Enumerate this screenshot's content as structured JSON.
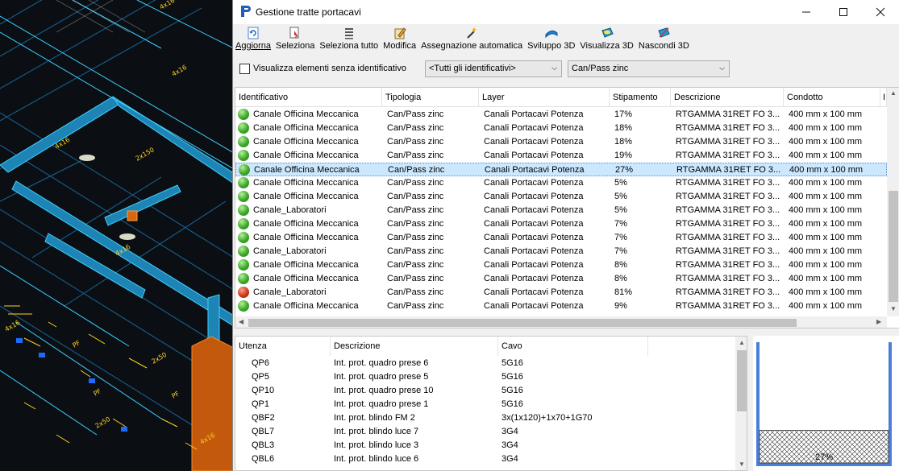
{
  "cad_labels": [
    "4x16",
    "4x16",
    "2x150",
    "4x16",
    "4x16",
    "PF",
    "PF",
    "2x50",
    "4x16",
    "2x50",
    "PF",
    "4x16"
  ],
  "window": {
    "title": "Gestione tratte portacavi",
    "icon": "app-logo-icon"
  },
  "toolbar": [
    {
      "label": "Aggiorna",
      "icon": "refresh-icon"
    },
    {
      "label": "Seleziona",
      "icon": "select-icon"
    },
    {
      "label": "Seleziona tutto",
      "icon": "select-all-icon"
    },
    {
      "label": "Modifica",
      "icon": "edit-icon"
    },
    {
      "label": "Assegnazione automatica",
      "icon": "magic-wand-icon"
    },
    {
      "label": "Sviluppo 3D",
      "icon": "develop-3d-icon"
    },
    {
      "label": "Visualizza 3D",
      "icon": "view-3d-icon"
    },
    {
      "label": "Nascondi 3D",
      "icon": "hide-3d-icon"
    }
  ],
  "filters": {
    "checkbox_label": "Visualizza elementi senza identificativo",
    "checkbox_checked": false,
    "identifier_select": "<Tutti gli identificativi>",
    "typology_select": "Can/Pass zinc"
  },
  "grid": {
    "columns": [
      "Identificativo",
      "Tipologia",
      "Layer",
      "Stipamento",
      "Descrizione",
      "Condotto",
      "I"
    ],
    "rows": [
      {
        "status": "green",
        "id": "Canale Officina Meccanica",
        "tipologia": "Can/Pass zinc",
        "layer": "Canali Portacavi Potenza",
        "stipamento": "17%",
        "descrizione": "RTGAMMA 31RET FO 3...",
        "condotto": "400 mm x 100 mm"
      },
      {
        "status": "green",
        "id": "Canale Officina Meccanica",
        "tipologia": "Can/Pass zinc",
        "layer": "Canali Portacavi Potenza",
        "stipamento": "18%",
        "descrizione": "RTGAMMA 31RET FO 3...",
        "condotto": "400 mm x 100 mm"
      },
      {
        "status": "green",
        "id": "Canale Officina Meccanica",
        "tipologia": "Can/Pass zinc",
        "layer": "Canali Portacavi Potenza",
        "stipamento": "18%",
        "descrizione": "RTGAMMA 31RET FO 3...",
        "condotto": "400 mm x 100 mm"
      },
      {
        "status": "green",
        "id": "Canale Officina Meccanica",
        "tipologia": "Can/Pass zinc",
        "layer": "Canali Portacavi Potenza",
        "stipamento": "19%",
        "descrizione": "RTGAMMA 31RET FO 3...",
        "condotto": "400 mm x 100 mm"
      },
      {
        "status": "green",
        "id": "Canale Officina Meccanica",
        "tipologia": "Can/Pass zinc",
        "layer": "Canali Portacavi Potenza",
        "stipamento": "27%",
        "descrizione": "RTGAMMA 31RET FO 3...",
        "condotto": "400 mm x 100 mm",
        "selected": true
      },
      {
        "status": "green",
        "id": "Canale Officina Meccanica",
        "tipologia": "Can/Pass zinc",
        "layer": "Canali Portacavi Potenza",
        "stipamento": "5%",
        "descrizione": "RTGAMMA 31RET FO 3...",
        "condotto": "400 mm x 100 mm"
      },
      {
        "status": "green",
        "id": "Canale Officina Meccanica",
        "tipologia": "Can/Pass zinc",
        "layer": "Canali Portacavi Potenza",
        "stipamento": "5%",
        "descrizione": "RTGAMMA 31RET FO 3...",
        "condotto": "400 mm x 100 mm"
      },
      {
        "status": "green",
        "id": "Canale_Laboratori",
        "tipologia": "Can/Pass zinc",
        "layer": "Canali Portacavi Potenza",
        "stipamento": "5%",
        "descrizione": "RTGAMMA 31RET FO 3...",
        "condotto": "400 mm x 100 mm"
      },
      {
        "status": "green",
        "id": "Canale Officina Meccanica",
        "tipologia": "Can/Pass zinc",
        "layer": "Canali Portacavi Potenza",
        "stipamento": "7%",
        "descrizione": "RTGAMMA 31RET FO 3...",
        "condotto": "400 mm x 100 mm"
      },
      {
        "status": "green",
        "id": "Canale Officina Meccanica",
        "tipologia": "Can/Pass zinc",
        "layer": "Canali Portacavi Potenza",
        "stipamento": "7%",
        "descrizione": "RTGAMMA 31RET FO 3...",
        "condotto": "400 mm x 100 mm"
      },
      {
        "status": "green",
        "id": "Canale_Laboratori",
        "tipologia": "Can/Pass zinc",
        "layer": "Canali Portacavi Potenza",
        "stipamento": "7%",
        "descrizione": "RTGAMMA 31RET FO 3...",
        "condotto": "400 mm x 100 mm"
      },
      {
        "status": "green",
        "id": "Canale Officina Meccanica",
        "tipologia": "Can/Pass zinc",
        "layer": "Canali Portacavi Potenza",
        "stipamento": "8%",
        "descrizione": "RTGAMMA 31RET FO 3...",
        "condotto": "400 mm x 100 mm"
      },
      {
        "status": "green",
        "id": "Canale Officina Meccanica",
        "tipologia": "Can/Pass zinc",
        "layer": "Canali Portacavi Potenza",
        "stipamento": "8%",
        "descrizione": "RTGAMMA 31RET FO 3...",
        "condotto": "400 mm x 100 mm"
      },
      {
        "status": "red",
        "id": "Canale_Laboratori",
        "tipologia": "Can/Pass zinc",
        "layer": "Canali Portacavi Potenza",
        "stipamento": "81%",
        "descrizione": "RTGAMMA 31RET FO 3...",
        "condotto": "400 mm x 100 mm"
      },
      {
        "status": "green",
        "id": "Canale Officina Meccanica",
        "tipologia": "Can/Pass zinc",
        "layer": "Canali Portacavi Potenza",
        "stipamento": "9%",
        "descrizione": "RTGAMMA 31RET FO 3...",
        "condotto": "400 mm x 100 mm"
      }
    ]
  },
  "cables": {
    "columns": [
      "Utenza",
      "Descrizione",
      "Cavo"
    ],
    "rows": [
      {
        "utenza": "QP6",
        "descrizione": "Int. prot. quadro prese 6",
        "cavo": "5G16"
      },
      {
        "utenza": "QP5",
        "descrizione": "Int. prot. quadro prese 5",
        "cavo": "5G16"
      },
      {
        "utenza": "QP10",
        "descrizione": "Int. prot. quadro prese 10",
        "cavo": "5G16"
      },
      {
        "utenza": "QP1",
        "descrizione": "Int. prot. quadro prese 1",
        "cavo": "5G16"
      },
      {
        "utenza": "QBF2",
        "descrizione": "Int. prot. blindo FM 2",
        "cavo": "3x(1x120)+1x70+1G70"
      },
      {
        "utenza": "QBL7",
        "descrizione": "Int. prot. blindo luce 7",
        "cavo": "3G4"
      },
      {
        "utenza": "QBL3",
        "descrizione": "Int. prot. blindo luce 3",
        "cavo": "3G4"
      },
      {
        "utenza": "QBL6",
        "descrizione": "Int. prot. blindo luce 6",
        "cavo": "3G4"
      }
    ]
  },
  "preview": {
    "fill_label": "27%",
    "fill_fraction": 0.27
  },
  "colors": {
    "selection": "#cce8ff",
    "accent": "#4a7fd8",
    "status_ok": "#3ea829",
    "status_error": "#d0371d"
  }
}
